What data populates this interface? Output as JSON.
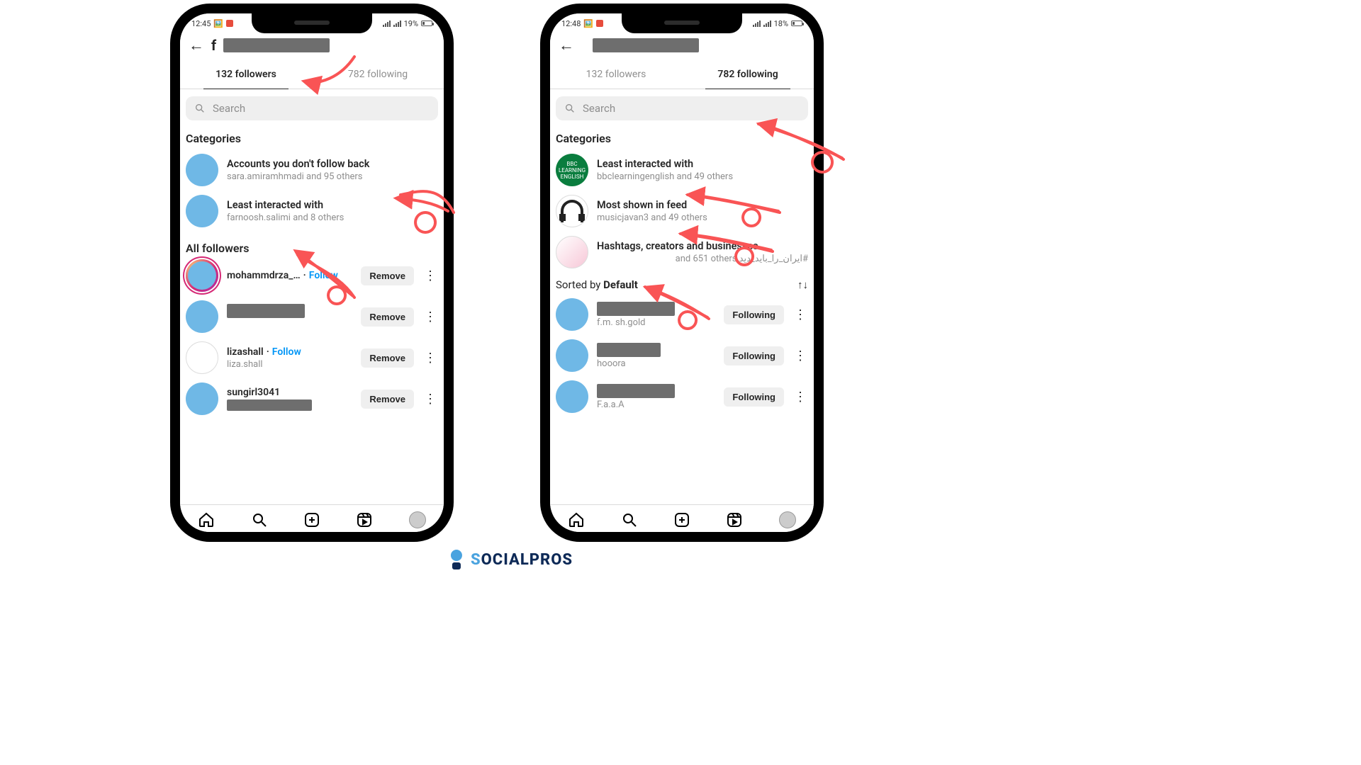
{
  "brand": {
    "name": "SOCIALPROS"
  },
  "phones": {
    "left": {
      "status": {
        "time": "12:45",
        "battery": "19%"
      },
      "tabs": {
        "followers": "132 followers",
        "following": "782 following",
        "active": "followers"
      },
      "search_placeholder": "Search",
      "section_categories": "Categories",
      "categories": [
        {
          "title": "Accounts you don't follow back",
          "sub": "sara.amiramhmadi and 95 others"
        },
        {
          "title": "Least interacted with",
          "sub": "farnoosh.salimi and 8 others"
        }
      ],
      "section_list": "All followers",
      "action_label": "Remove",
      "follow_label": "Follow",
      "people": [
        {
          "name": "mohammdrza_…",
          "sub": "",
          "follow_link": true,
          "avatar": "story"
        },
        {
          "name": "",
          "sub": "",
          "follow_link": false,
          "avatar": "cover",
          "redacted": true
        },
        {
          "name": "lizashall",
          "sub": "liza.shall",
          "follow_link": true,
          "avatar": "lined"
        },
        {
          "name": "sungirl3041",
          "sub": "",
          "follow_link": false,
          "avatar": "cover",
          "redacted_sub": true
        }
      ]
    },
    "right": {
      "status": {
        "time": "12:48",
        "battery": "18%"
      },
      "tabs": {
        "followers": "132 followers",
        "following": "782 following",
        "active": "following"
      },
      "search_placeholder": "Search",
      "section_categories": "Categories",
      "categories": [
        {
          "title": "Least interacted with",
          "sub": "bbclearningenglish and 49 others",
          "avatar": "green"
        },
        {
          "title": "Most shown in feed",
          "sub": "musicjavan3 and 49 others",
          "avatar": "headphones"
        },
        {
          "title": "Hashtags, creators and businesses",
          "sub": "#ایران_را_باید_دید and 651 others",
          "avatar": "lined"
        }
      ],
      "sorted_label": "Sorted by ",
      "sorted_value": "Default",
      "action_label": "Following",
      "people": [
        {
          "name": "",
          "sub": "f.m. sh.gold",
          "avatar": "cover",
          "redacted": true
        },
        {
          "name": "",
          "sub": "hooora",
          "avatar": "cover",
          "redacted": true
        },
        {
          "name": "",
          "sub": "F.a.a.A",
          "avatar": "cover",
          "redacted": true
        }
      ]
    }
  }
}
